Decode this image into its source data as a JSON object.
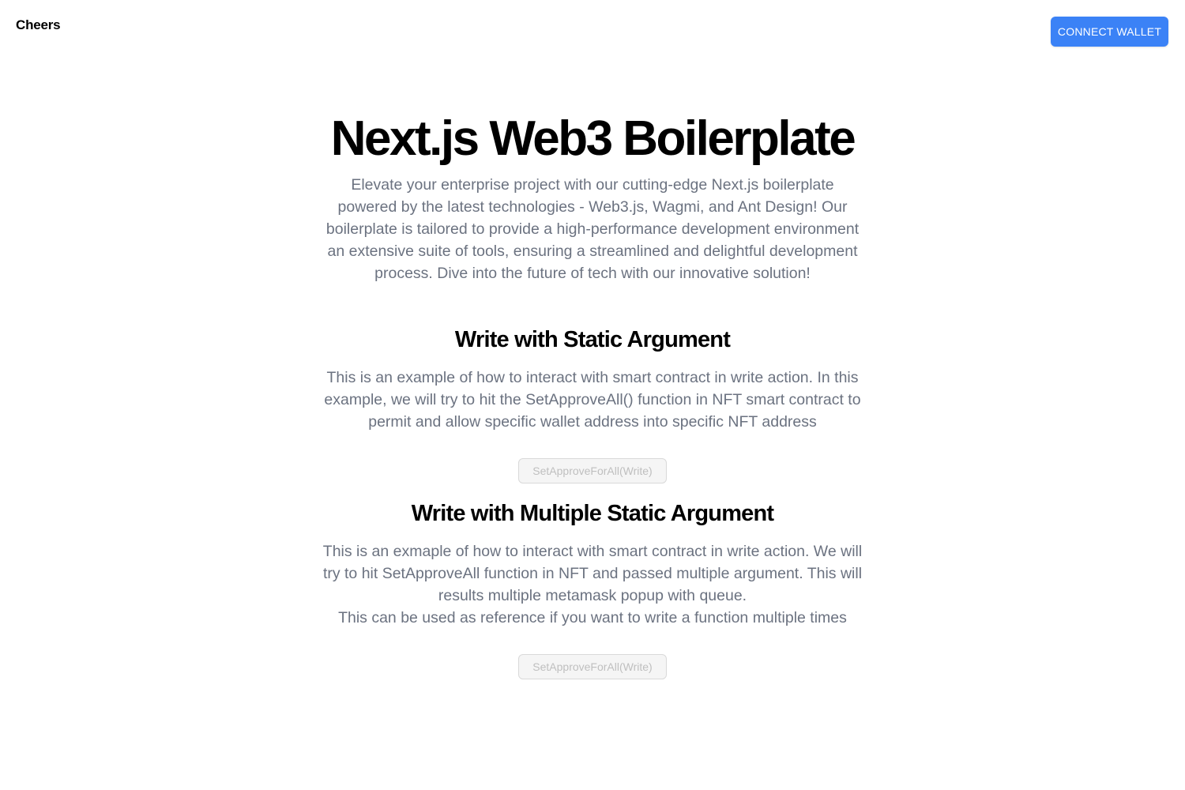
{
  "navbar": {
    "brand": "Cheers",
    "connect_label": "CONNECT WALLET"
  },
  "hero": {
    "title": "Next.js Web3 Boilerplate",
    "description": "Elevate your enterprise project with our cutting-edge Next.js boilerplate powered by the latest technologies - Web3.js, Wagmi, and Ant Design! Our boilerplate is tailored to provide a high-performance development environment an extensive suite of tools, ensuring a streamlined and delightful development process. Dive into the future of tech with our innovative solution!"
  },
  "sections": [
    {
      "title": "Write with Static Argument",
      "description": "This is an example of how to interact with smart contract in write action. In this example, we will try to hit the SetApproveAll() function in NFT smart contract to permit and allow specific wallet address into specific NFT address",
      "button_label": "SetApproveForAll(Write)"
    },
    {
      "title": "Write with Multiple Static Argument",
      "description": "This is an exmaple of how to interact with smart contract in write action. We will try to hit SetApproveAll function in NFT and passed multiple argument. This will results multiple metamask popup with queue.\nThis can be used as reference if you want to write a function multiple times",
      "button_label": "SetApproveForAll(Write)"
    }
  ],
  "colors": {
    "primary_button": "#3b82f6",
    "muted_text": "#6b7280",
    "disabled_button_bg": "#f5f5f5",
    "disabled_button_text": "#bfbfbf"
  }
}
